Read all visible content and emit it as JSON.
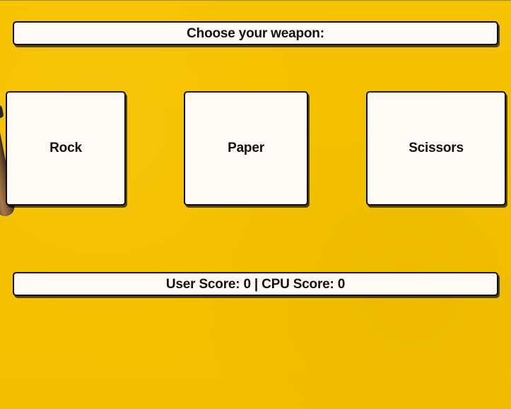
{
  "header": {
    "prompt": "Choose your weapon:"
  },
  "choices": [
    {
      "label": "Rock"
    },
    {
      "label": "Paper"
    },
    {
      "label": "Scissors"
    }
  ],
  "scoreboard": {
    "text": "User Score: 0 | CPU Score: 0"
  }
}
